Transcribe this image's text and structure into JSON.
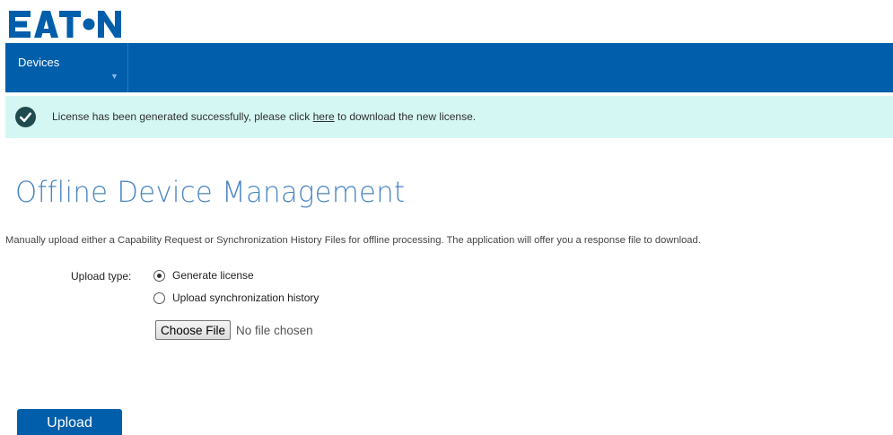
{
  "brand": {
    "logo_text": "EATON",
    "color": "#005eab"
  },
  "nav": {
    "items": [
      {
        "label": "Devices",
        "icon": "caret-down-icon"
      }
    ]
  },
  "alert": {
    "icon": "check-circle-icon",
    "text_before": "License has been generated successfully, please click ",
    "link_text": "here",
    "text_after": " to download the new license.",
    "background": "#d5f7f3"
  },
  "page": {
    "title": "Offline Device Management",
    "description": "Manually upload either a Capability Request or Synchronization History Files for offline processing. The application will offer you a response file to download."
  },
  "form": {
    "upload_type_label": "Upload type:",
    "options": [
      {
        "label": "Generate license",
        "selected": true
      },
      {
        "label": "Upload synchronization history",
        "selected": false
      }
    ],
    "choose_file_label": "Choose File",
    "file_status": "No file chosen",
    "upload_label": "Upload"
  }
}
